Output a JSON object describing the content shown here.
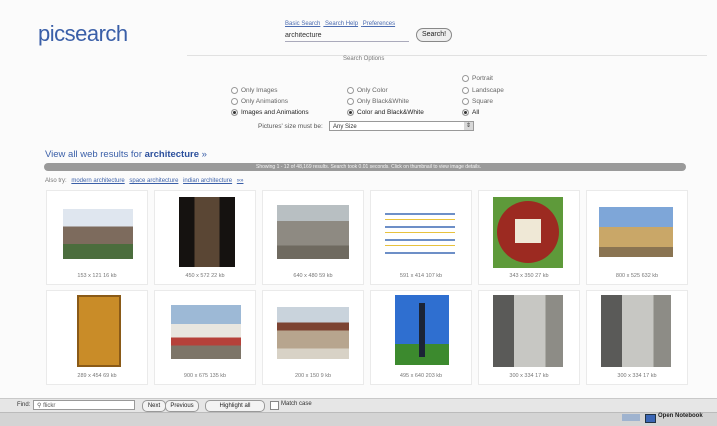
{
  "logo": "picsearch",
  "top_links": [
    "Basic Search",
    "Search Help",
    "Preferences"
  ],
  "search": {
    "value": "architecture",
    "button": "Search!"
  },
  "options": {
    "title": "Search Options",
    "type": [
      "Only Images",
      "Only Animations",
      "Images and Animations"
    ],
    "color": [
      "Only Color",
      "Only Black&White",
      "Color and Black&White"
    ],
    "orientation": [
      "Portrait",
      "Landscape",
      "Square",
      "All"
    ],
    "size_label": "Pictures' size must be:",
    "size_value": "Any Size"
  },
  "view_all": {
    "prefix": "View all web results for ",
    "term": "architecture",
    "suffix": " »"
  },
  "results_bar": "Showing 1 - 12 of 48,169 results. Search took 0.01 seconds. Click on thumbnail to view image details.",
  "also_try": {
    "label": "Also try:",
    "links": [
      "modern architecture",
      "space architecture",
      "indian architecture",
      "»»"
    ]
  },
  "results": [
    {
      "caption": "153 x 121   16 kb"
    },
    {
      "caption": "450 x 572   22 kb"
    },
    {
      "caption": "640 x 480   59 kb"
    },
    {
      "caption": "591 x 414   107 kb"
    },
    {
      "caption": "343 x 350   27 kb"
    },
    {
      "caption": "800 x 525   632 kb"
    },
    {
      "caption": "289 x 454   69 kb"
    },
    {
      "caption": "900 x 675   135 kb"
    },
    {
      "caption": "200 x 150   9 kb"
    },
    {
      "caption": "495 x 640   203 kb"
    },
    {
      "caption": "300 x 334   17 kb"
    },
    {
      "caption": "300 x 334   17 kb"
    }
  ],
  "findbar": {
    "label": "Find:",
    "value": "flickr",
    "next": "Next",
    "previous": "Previous",
    "highlight": "Highlight all",
    "match_case": "Match case"
  },
  "taskbar": {
    "item": "Open Notebook"
  }
}
